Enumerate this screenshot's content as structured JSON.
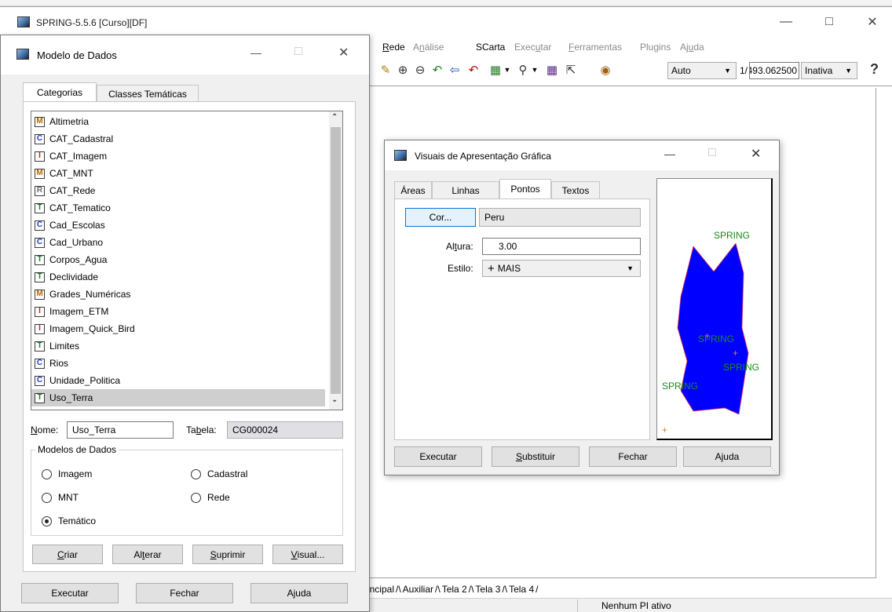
{
  "main": {
    "title": "SPRING-5.5.6 [Curso][DF]",
    "menu": [
      {
        "label": "Rede",
        "disabled": false
      },
      {
        "label": "Análise",
        "disabled": true
      },
      {
        "label": "SCarta",
        "disabled": false
      },
      {
        "label": "Executar",
        "disabled": true
      },
      {
        "label": "Ferramentas",
        "disabled": true
      },
      {
        "label": "Plugins",
        "disabled": true
      },
      {
        "label": "Ajuda",
        "disabled": true
      }
    ],
    "toolbar": {
      "auto_label": "Auto",
      "scale_prefix": "1/",
      "scale_value": "493.062500",
      "inativa_label": "Inativa",
      "help_icon": "question-icon"
    },
    "sheet_tabs": [
      "Principal",
      "Auxiliar",
      "Tela 2",
      "Tela 3",
      "Tela 4"
    ],
    "status": "Nenhum PI ativo"
  },
  "modelo": {
    "title": "Modelo de Dados",
    "tabs": [
      "Categorias",
      "Classes Temáticas"
    ],
    "categories": [
      {
        "type": "M",
        "name": "Altimetria"
      },
      {
        "type": "C",
        "name": "CAT_Cadastral"
      },
      {
        "type": "I",
        "name": "CAT_Imagem"
      },
      {
        "type": "M",
        "name": "CAT_MNT"
      },
      {
        "type": "R",
        "name": "CAT_Rede"
      },
      {
        "type": "T",
        "name": "CAT_Tematico"
      },
      {
        "type": "C",
        "name": "Cad_Escolas"
      },
      {
        "type": "C",
        "name": "Cad_Urbano"
      },
      {
        "type": "T",
        "name": "Corpos_Agua"
      },
      {
        "type": "T",
        "name": "Declividade"
      },
      {
        "type": "M",
        "name": "Grades_Numéricas"
      },
      {
        "type": "I",
        "name": "Imagem_ETM"
      },
      {
        "type": "I",
        "name": "Imagem_Quick_Bird"
      },
      {
        "type": "T",
        "name": "Limites"
      },
      {
        "type": "C",
        "name": "Rios"
      },
      {
        "type": "C",
        "name": "Unidade_Politica"
      },
      {
        "type": "T",
        "name": "Uso_Terra"
      }
    ],
    "selected_index": 16,
    "nome_label": "Nome:",
    "nome_value": "Uso_Terra",
    "tabela_label": "Tabela:",
    "tabela_value": "CG000024",
    "group_label": "Modelos de Dados",
    "radios": [
      {
        "label": "Imagem",
        "checked": false
      },
      {
        "label": "Cadastral",
        "checked": false
      },
      {
        "label": "MNT",
        "checked": false
      },
      {
        "label": "Rede",
        "checked": false
      },
      {
        "label": "Temático",
        "checked": true
      }
    ],
    "buttons": [
      "Criar",
      "Alterar",
      "Suprimir",
      "Visual..."
    ],
    "bottom_buttons": [
      "Executar",
      "Fechar",
      "Ajuda"
    ]
  },
  "visuais": {
    "title": "Visuais de Apresentação Gráfica",
    "tabs": [
      "Áreas",
      "Linhas",
      "Pontos",
      "Textos"
    ],
    "active_tab": "Pontos",
    "cor_button": "Cor...",
    "cor_value": "Peru",
    "altura_label": "Altura:",
    "altura_value": "3.00",
    "estilo_label": "Estilo:",
    "estilo_value": "MAIS",
    "preview_texts": [
      "SPRING",
      "SPRING",
      "SPRING",
      "SPRING"
    ],
    "buttons": [
      "Executar",
      "Substituir",
      "Fechar",
      "Ajuda"
    ]
  },
  "colors": {
    "badge_M": "#b36b00",
    "badge_C": "#1f3fbf",
    "badge_I": "#d11a1a",
    "badge_R": "#6a6a6a",
    "badge_T": "#1a7a2a",
    "polygon_fill": "#0000ff",
    "preview_text": "#1a8a1a",
    "point_color": "#cd853f"
  }
}
